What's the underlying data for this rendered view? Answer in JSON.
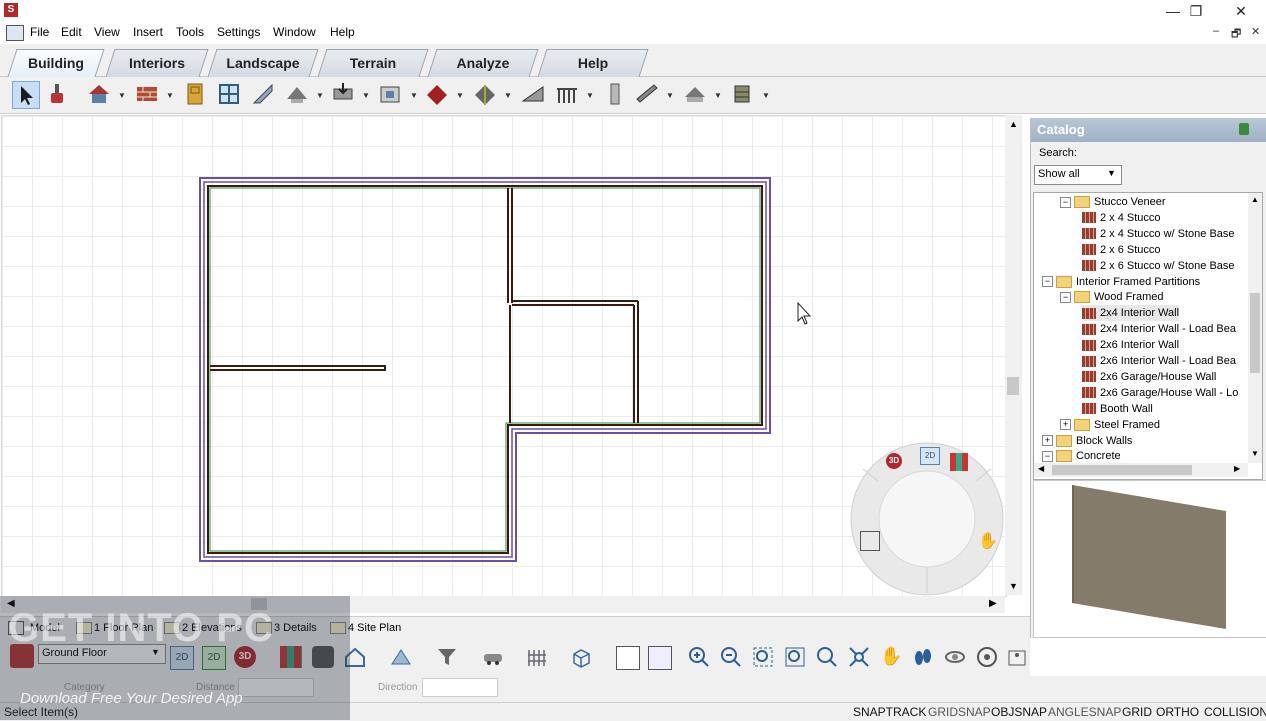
{
  "menu": {
    "items": [
      "File",
      "Edit",
      "View",
      "Insert",
      "Tools",
      "Settings",
      "Window",
      "Help"
    ]
  },
  "window_controls": {
    "minimize": "—",
    "maximize": "❐",
    "close": "✕"
  },
  "mdi_controls": {
    "minimize": "–",
    "restore": "🗗",
    "close": "✕"
  },
  "tabs": [
    "Building",
    "Interiors",
    "Landscape",
    "Terrain",
    "Analyze",
    "Help"
  ],
  "toolbar": {
    "icons": [
      "select-arrow-icon",
      "paint-brush-icon",
      "house-wizard-icon",
      "wall-icon",
      "door-icon",
      "window-icon",
      "stair-icon",
      "roof-icon",
      "foundation-icon",
      "opening-icon",
      "roof-plane-icon",
      "dormer-icon",
      "ramp-icon",
      "railing-icon",
      "column-icon",
      "beam-icon",
      "deck-icon",
      "cabinet-icon"
    ]
  },
  "catalog": {
    "title": "Catalog",
    "search_label": "Search:",
    "filter_value": "Show all",
    "tree": [
      {
        "level": 1,
        "type": "folder",
        "expand": "−",
        "label": "Stucco Veneer"
      },
      {
        "level": 2,
        "type": "item",
        "label": "2 x 4 Stucco"
      },
      {
        "level": 2,
        "type": "item",
        "label": "2 x 4 Stucco w/ Stone Base"
      },
      {
        "level": 2,
        "type": "item",
        "label": "2 x 6 Stucco"
      },
      {
        "level": 2,
        "type": "item",
        "label": "2 x 6 Stucco w/ Stone Base"
      },
      {
        "level": 0,
        "type": "folder",
        "expand": "−",
        "label": "Interior Framed Partitions"
      },
      {
        "level": 1,
        "type": "folder",
        "expand": "−",
        "label": "Wood Framed"
      },
      {
        "level": 2,
        "type": "item",
        "label": "2x4 Interior Wall",
        "selected": true
      },
      {
        "level": 2,
        "type": "item",
        "label": "2x4 Interior Wall - Load Bea"
      },
      {
        "level": 2,
        "type": "item",
        "label": "2x6 Interior Wall"
      },
      {
        "level": 2,
        "type": "item",
        "label": "2x6 Interior Wall - Load Bea"
      },
      {
        "level": 2,
        "type": "item",
        "label": "2x6 Garage/House Wall"
      },
      {
        "level": 2,
        "type": "item",
        "label": "2x6 Garage/House Wall - Lo"
      },
      {
        "level": 2,
        "type": "item",
        "label": "Booth Wall"
      },
      {
        "level": 1,
        "type": "folder",
        "expand": "+",
        "label": "Steel Framed"
      },
      {
        "level": 0,
        "type": "folder",
        "expand": "+",
        "label": "Block Walls"
      },
      {
        "level": 0,
        "type": "folder",
        "expand": "−",
        "label": "Concrete"
      }
    ]
  },
  "nav_wheel": {
    "label_3d": "3D",
    "label_2d": "2D"
  },
  "view_tabs": [
    "Model",
    "1 Floor Plan",
    "2 Elevations",
    "3 Details",
    "4 Site Plan"
  ],
  "floor_select": "Ground Floor",
  "bottom_labels": {
    "view_2d": "2D",
    "view_2d_alt": "2D",
    "view_3d": "3D"
  },
  "options": {
    "category": "Category",
    "distance": "Distance",
    "direction": "Direction"
  },
  "status": {
    "left": "Select Item(s)",
    "toggles": [
      "SNAPTRACK",
      "GRIDSNAP",
      "OBJSNAP",
      "ANGLESNAP",
      "GRID",
      "ORTHO",
      "COLLISION"
    ]
  },
  "watermark": {
    "title": "GET INTO PC",
    "subtitle": "Download Free Your Desired App"
  }
}
